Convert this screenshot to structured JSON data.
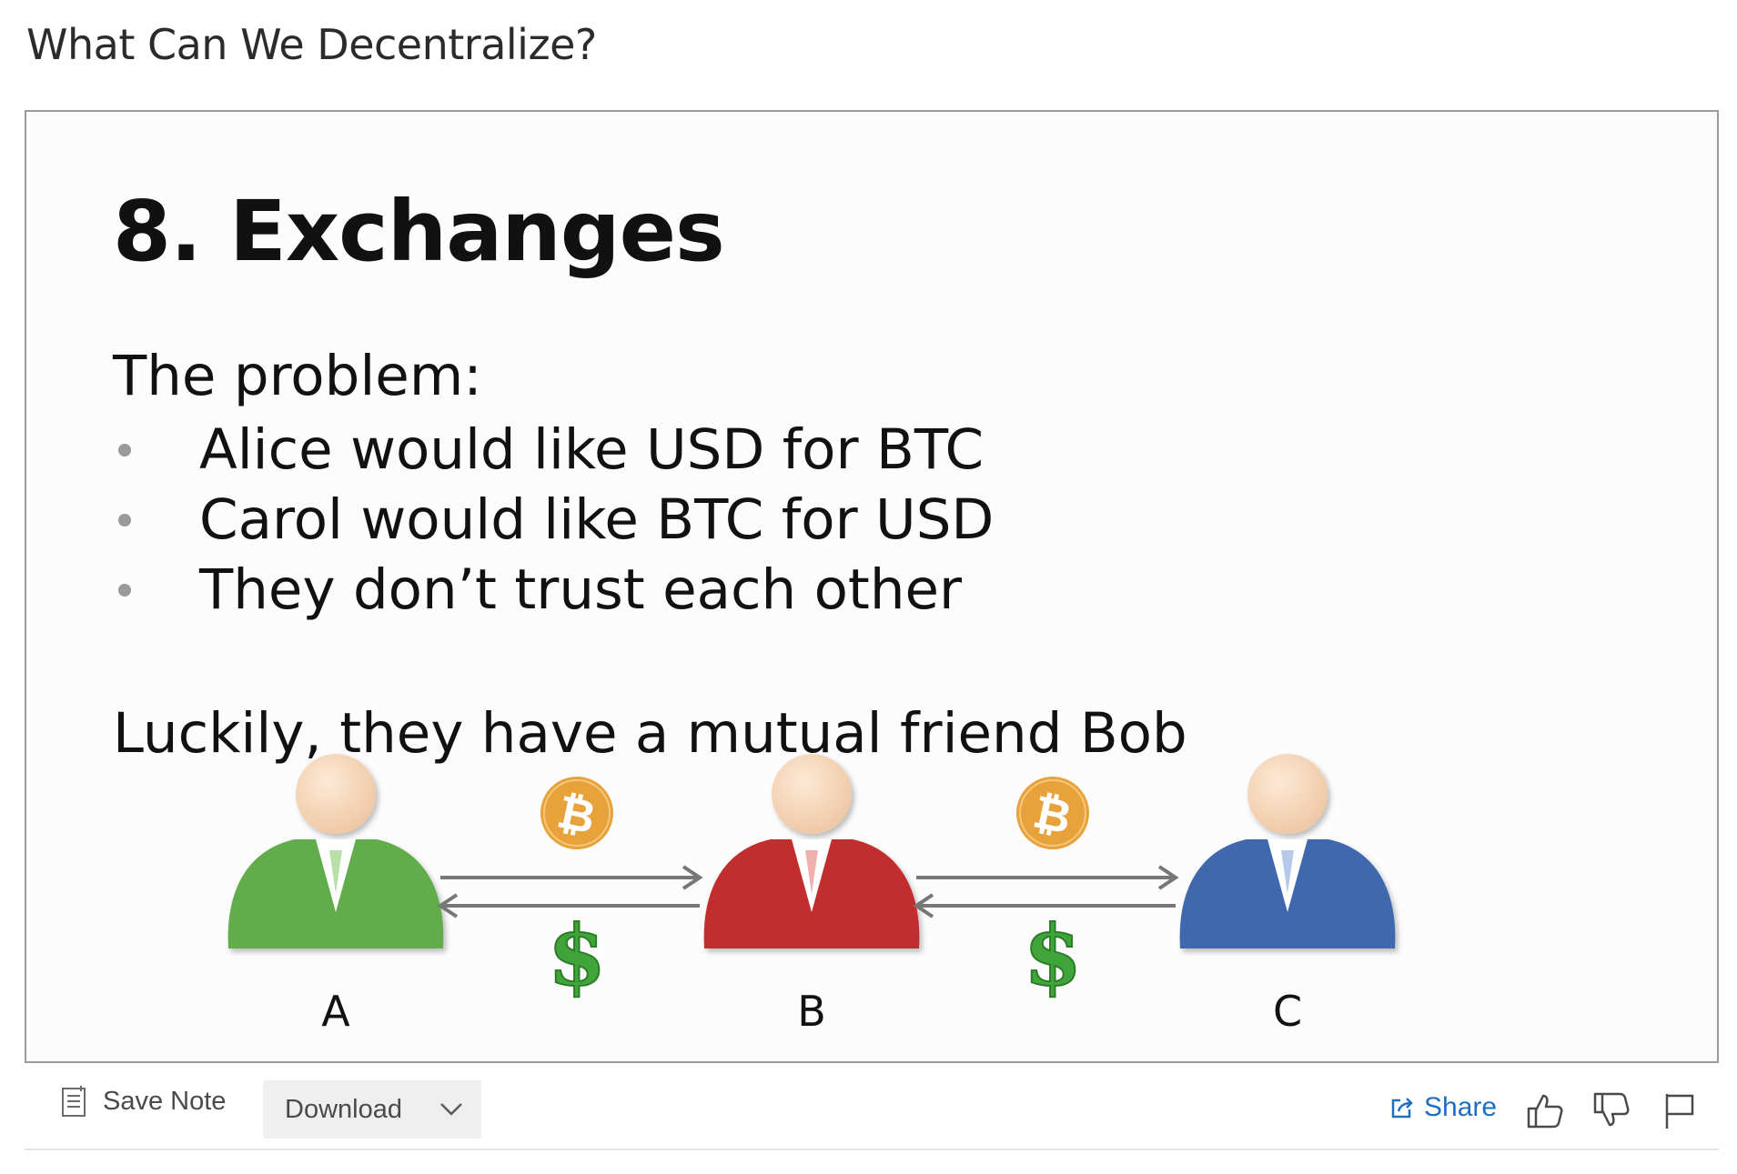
{
  "page": {
    "title": "What Can We Decentralize?"
  },
  "slide": {
    "title": "8. Exchanges",
    "problem_heading": "The problem:",
    "bullets": [
      "Alice would like USD for BTC",
      "Carol would like BTC for USD",
      "They don’t trust each other"
    ],
    "luckily": "Luckily, they have a mutual friend Bob",
    "diagram": {
      "people": [
        {
          "label": "A",
          "color": "#5faa4a"
        },
        {
          "label": "B",
          "color": "#c0302e"
        },
        {
          "label": "C",
          "color": "#3f67ad"
        }
      ],
      "bitcoin_symbol": "₿",
      "dollar_symbol": "$",
      "bitcoin_color": "#e8a23c",
      "dollar_color": "#3fa53a"
    }
  },
  "toolbar": {
    "save_note_label": "Save Note",
    "download_label": "Download",
    "share_label": "Share"
  },
  "icons": {
    "save_note": "note-icon",
    "download_chevron": "chevron-down-icon",
    "share": "external-share-icon",
    "like": "thumbs-up-icon",
    "dislike": "thumbs-down-icon",
    "flag": "flag-icon"
  },
  "colors": {
    "link_blue": "#1f6fc1",
    "frame_border": "#9a9a9a"
  }
}
